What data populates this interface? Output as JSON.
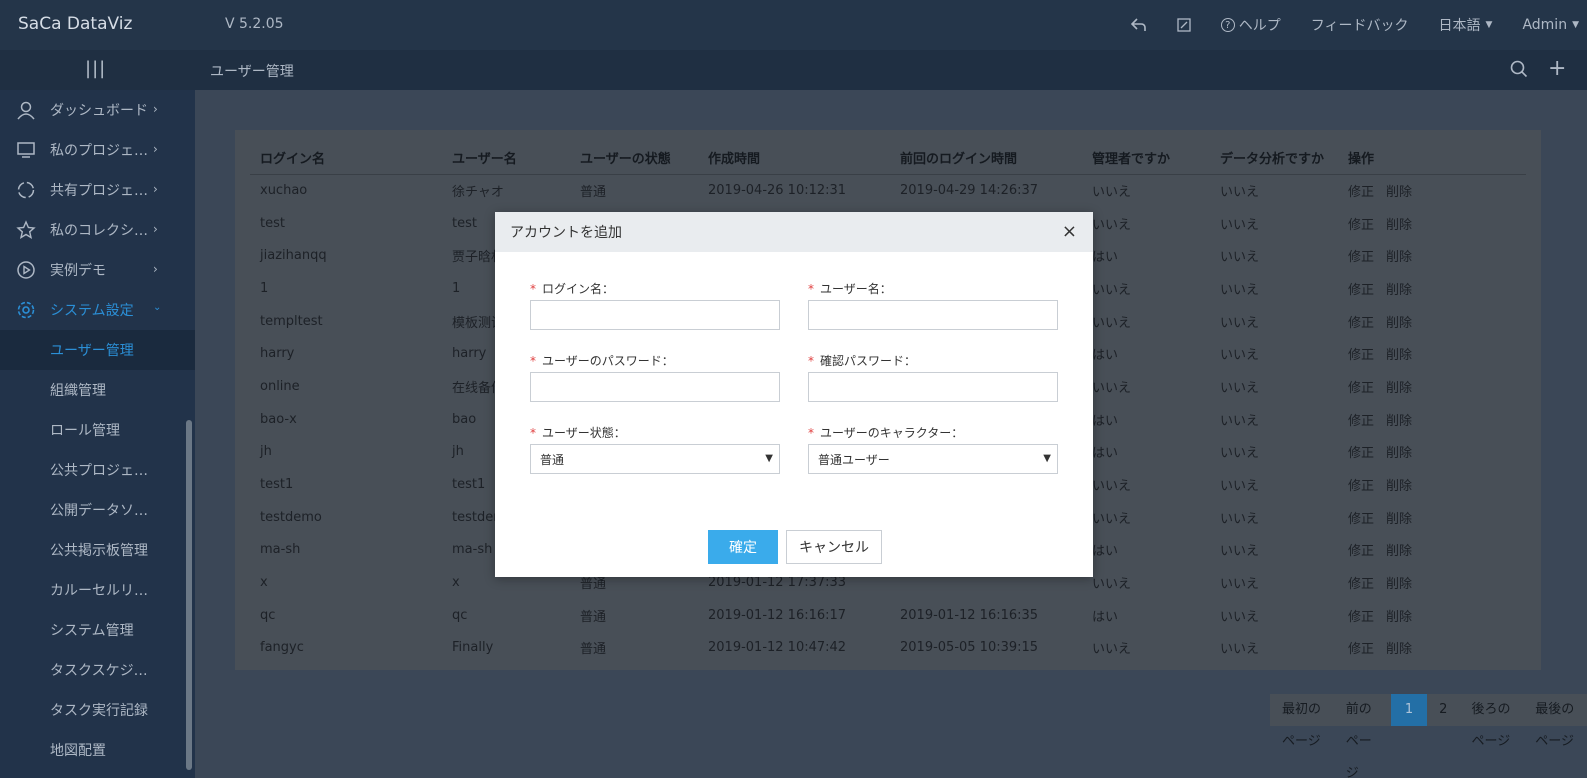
{
  "app": {
    "logo": "SaCa DataViz",
    "version": "V 5.2.05"
  },
  "topnav": {
    "back_icon": "back-arrow-icon",
    "edit_icon": "edit-icon",
    "help": "ヘルプ",
    "feedback": "フィードバック",
    "language": "日本語",
    "user": "Admin"
  },
  "subbar": {
    "title": "ユーザー管理"
  },
  "sidebar": {
    "items": [
      {
        "label": "ダッシュボード",
        "icon": "user-icon"
      },
      {
        "label": "私のプロジェ…",
        "icon": "monitor-icon"
      },
      {
        "label": "共有プロジェ…",
        "icon": "share-icon"
      },
      {
        "label": "私のコレクシ…",
        "icon": "star-icon"
      },
      {
        "label": "実例デモ",
        "icon": "play-icon"
      },
      {
        "label": "システム設定",
        "icon": "gear-icon"
      }
    ],
    "subitems": [
      "ユーザー管理",
      "組織管理",
      "ロール管理",
      "公共プロジェ…",
      "公開データソ…",
      "公共掲示板管理",
      "カルーセルリ…",
      "システム管理",
      "タスクスケジ…",
      "タスク実行記録",
      "地図配置"
    ]
  },
  "table": {
    "headers": [
      "ログイン名",
      "ユーザー名",
      "ユーザーの状態",
      "作成時間",
      "前回のログイン時間",
      "管理者ですか",
      "データ分析ですか",
      "操作"
    ],
    "edit_label": "修正",
    "delete_label": "削除",
    "rows": [
      [
        "xuchao",
        "徐チャオ",
        "普通",
        "2019-04-26 10:12:31",
        "2019-04-29 14:26:37",
        "いいえ",
        "いいえ"
      ],
      [
        "test",
        "test",
        "",
        "",
        "",
        "いいえ",
        "いいえ"
      ],
      [
        "jiazihanqq",
        "贾子晗林",
        "",
        "",
        "",
        "はい",
        "いいえ"
      ],
      [
        "1",
        "1",
        "",
        "",
        "",
        "いいえ",
        "いいえ"
      ],
      [
        "templtest",
        "模板测试",
        "",
        "",
        "",
        "いいえ",
        "いいえ"
      ],
      [
        "harry",
        "harry",
        "",
        "",
        "",
        "はい",
        "いいえ"
      ],
      [
        "online",
        "在线备份",
        "",
        "",
        "",
        "いいえ",
        "いいえ"
      ],
      [
        "bao-x",
        "bao",
        "",
        "",
        "",
        "はい",
        "いいえ"
      ],
      [
        "jh",
        "jh",
        "",
        "",
        "",
        "はい",
        "いいえ"
      ],
      [
        "test1",
        "test1",
        "",
        "",
        "",
        "いいえ",
        "いいえ"
      ],
      [
        "testdemo",
        "testdem",
        "",
        "",
        "",
        "いいえ",
        "いいえ"
      ],
      [
        "ma-sh",
        "ma-sh",
        "",
        "",
        "",
        "はい",
        "いいえ"
      ],
      [
        "x",
        "x",
        "普通",
        "2019-01-12 17:37:33",
        "",
        "いいえ",
        "いいえ"
      ],
      [
        "qc",
        "qc",
        "普通",
        "2019-01-12 16:16:17",
        "2019-01-12 16:16:35",
        "はい",
        "いいえ"
      ],
      [
        "fangyc",
        "Finally",
        "普通",
        "2019-01-12 10:47:42",
        "2019-05-05 10:39:15",
        "いいえ",
        "いいえ"
      ]
    ]
  },
  "pagination": {
    "first": "最初のページ",
    "prev": "前のページ",
    "pages": [
      "1",
      "2"
    ],
    "current": "1",
    "next": "後ろのページ",
    "last": "最後のページ"
  },
  "modal": {
    "title": "アカウントを追加",
    "login_label": "ログイン名：",
    "username_label": "ユーザー名：",
    "password_label": "ユーザーのパスワード：",
    "confirm_password_label": "確認パスワード：",
    "status_label": "ユーザー状態：",
    "status_value": "普通",
    "role_label": "ユーザーのキャラクター：",
    "role_value": "普通ユーザー",
    "required_mark": "*",
    "ok": "確定",
    "cancel": "キャンセル",
    "close": "×"
  }
}
